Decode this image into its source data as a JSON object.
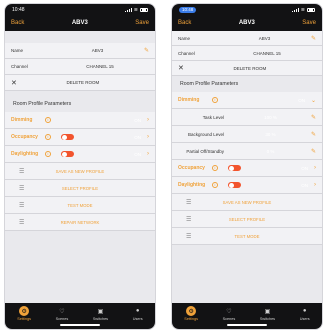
{
  "left": {
    "status": {
      "time": "10:48"
    },
    "nav": {
      "back": "Back",
      "title": "ABV3",
      "save": "Save"
    },
    "name": {
      "label": "Name",
      "value": "ABV3"
    },
    "channel": {
      "label": "Channel",
      "value": "CHANNEL 15"
    },
    "delete_label": "DELETE ROOM",
    "section_title": "Room Profile Parameters",
    "params": [
      {
        "label": "Dimming",
        "value": "ON"
      },
      {
        "label": "Occupancy",
        "value": "ON"
      },
      {
        "label": "Daylighting",
        "value": "ON"
      }
    ],
    "actions": [
      "SAVE AS NEW PROFILE",
      "SELECT PROFILE",
      "TEST MODE",
      "REPAIR NETWORK"
    ],
    "tabs": [
      "Settings",
      "Scenes",
      "Switches",
      "Users"
    ]
  },
  "right": {
    "status": {
      "time": "10:48"
    },
    "nav": {
      "back": "Back",
      "title": "ABV3",
      "save": "Save"
    },
    "name": {
      "label": "Name",
      "value": "ABV3"
    },
    "channel": {
      "label": "Channel",
      "value": "CHANNEL 15"
    },
    "delete_label": "DELETE ROOM",
    "section_title": "Room Profile Parameters",
    "dimming": {
      "label": "Dimming",
      "value": "ON"
    },
    "subs": [
      {
        "label": "Task Level",
        "value": "100 %"
      },
      {
        "label": "Background Level",
        "value": "30 %"
      },
      {
        "label": "Partial Off/Standby",
        "value": "0 %"
      }
    ],
    "params": [
      {
        "label": "Occupancy",
        "value": "ON"
      },
      {
        "label": "Daylighting",
        "value": "ON"
      }
    ],
    "actions": [
      "SAVE AS NEW PROFILE",
      "SELECT PROFILE",
      "TEST MODE"
    ],
    "tabs": [
      "Settings",
      "Scenes",
      "Switches",
      "Users"
    ]
  },
  "colors": {
    "accent": "#f0a23a",
    "toggle_on": "#f2542d",
    "dark": "#121214",
    "status_pill": "#3b7de9"
  }
}
